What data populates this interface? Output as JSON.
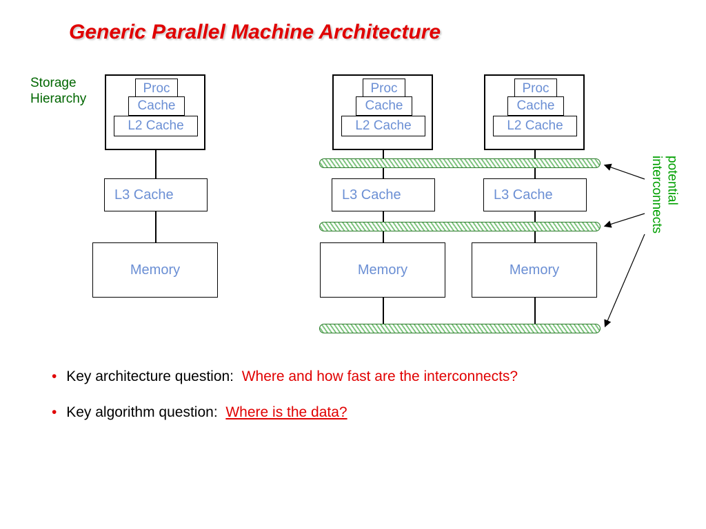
{
  "title": "Generic Parallel Machine Architecture",
  "labels": {
    "storage1": "Storage",
    "storage2": "Hierarchy",
    "interconnects1": "potential",
    "interconnects2": "interconnects"
  },
  "nodes": {
    "proc": "Proc",
    "cache": "Cache",
    "l2": "L2 Cache",
    "l3": "L3 Cache",
    "memory": "Memory"
  },
  "bullets": {
    "q1_label": "Key architecture question:",
    "q1_answer": "Where and how fast are the interconnects?",
    "q2_label": "Key algorithm question:",
    "q2_answer": "Where is the data?"
  }
}
